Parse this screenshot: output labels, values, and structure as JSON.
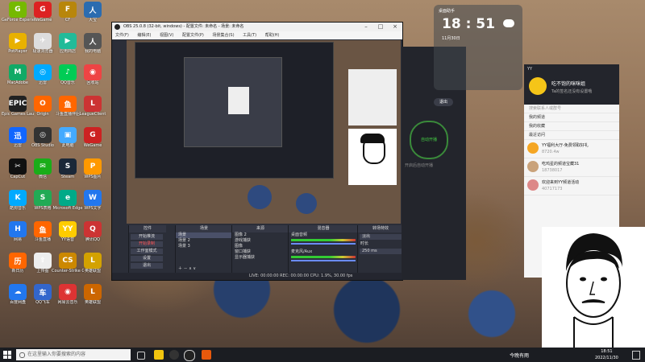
{
  "desktop": {
    "icons": [
      {
        "label": "GeForce Experience",
        "color": "#76b900",
        "glyph": "G"
      },
      {
        "label": "WeGame",
        "color": "#d22",
        "glyph": "G"
      },
      {
        "label": "CF",
        "color": "#b8860b",
        "glyph": "F"
      },
      {
        "label": "大宝",
        "color": "#2b6cb0",
        "glyph": "人"
      },
      {
        "label": "PotPlayer",
        "color": "#e8b100",
        "glyph": "▶"
      },
      {
        "label": "极速浏览器",
        "color": "#ddd",
        "glyph": "✈"
      },
      {
        "label": "应用商店",
        "color": "#2b9",
        "glyph": "▶"
      },
      {
        "label": "我的电脑",
        "color": "#555",
        "glyph": "人"
      },
      {
        "label": "MacAdobe",
        "color": "#1a6",
        "glyph": "M"
      },
      {
        "label": "迅雷",
        "color": "#0af",
        "glyph": "◎"
      },
      {
        "label": "QQ音乐",
        "color": "#0c5",
        "glyph": "♪"
      },
      {
        "label": "回收站",
        "color": "#e44",
        "glyph": "◉"
      },
      {
        "label": "Epic Games Launcher",
        "color": "#222",
        "glyph": "EPIC"
      },
      {
        "label": "Origin",
        "color": "#f60",
        "glyph": "O"
      },
      {
        "label": "斗鱼直播伴侣",
        "color": "#f60",
        "glyph": "鱼"
      },
      {
        "label": "LeagueClient",
        "color": "#c33",
        "glyph": "L"
      },
      {
        "label": "迅雷",
        "color": "#16f",
        "glyph": "迅"
      },
      {
        "label": "OBS Studio",
        "color": "#333",
        "glyph": "◎"
      },
      {
        "label": "此电脑",
        "color": "#4af",
        "glyph": "▣"
      },
      {
        "label": "WeGame",
        "color": "#c22",
        "glyph": "G"
      },
      {
        "label": "CapCut",
        "color": "#111",
        "glyph": "✂"
      },
      {
        "label": "微信",
        "color": "#1aad19",
        "glyph": "✉"
      },
      {
        "label": "Steam",
        "color": "#1b2838",
        "glyph": "S"
      },
      {
        "label": "WPS图片",
        "color": "#f90",
        "glyph": "P"
      },
      {
        "label": "酷狗音乐",
        "color": "#0af",
        "glyph": "K"
      },
      {
        "label": "WPS表格",
        "color": "#2a5",
        "glyph": "S"
      },
      {
        "label": "Microsoft Edge",
        "color": "#0a8",
        "glyph": "e"
      },
      {
        "label": "WPS文字",
        "color": "#27e",
        "glyph": "W"
      },
      {
        "label": "网易",
        "color": "#27e",
        "glyph": "H"
      },
      {
        "label": "斗鱼直播",
        "color": "#f60",
        "glyph": "鱼"
      },
      {
        "label": "YY语音",
        "color": "#fc0",
        "glyph": "YY"
      },
      {
        "label": "腾讯QQ",
        "color": "#c33",
        "glyph": "Q"
      },
      {
        "label": "新日历",
        "color": "#f60",
        "glyph": "历"
      },
      {
        "label": "上传图",
        "color": "#eee",
        "glyph": "⇧"
      },
      {
        "label": "Counter-Strike Global",
        "color": "#c80",
        "glyph": "CS"
      },
      {
        "label": "英雄联盟",
        "color": "#d3a200",
        "glyph": "L"
      },
      {
        "label": "百度网盘",
        "color": "#27e",
        "glyph": "☁"
      },
      {
        "label": "QQ飞车",
        "color": "#36c",
        "glyph": "车"
      },
      {
        "label": "网易云音乐",
        "color": "#d33",
        "glyph": "◉"
      },
      {
        "label": "英雄联盟",
        "color": "#c60",
        "glyph": "L"
      }
    ]
  },
  "obs": {
    "title": "OBS 25.0.8 (32-bit, windows) - 配置文件: 未命名 - 场景: 未命名",
    "menu": [
      "文件(F)",
      "编辑(E)",
      "视图(V)",
      "配置文件(P)",
      "场景集合(S)",
      "工具(T)",
      "帮助(H)"
    ],
    "docks": {
      "scenes": {
        "title": "场景",
        "items": [
          "场景",
          "场景 2",
          "场景 3"
        ]
      },
      "sources": {
        "title": "来源",
        "items": [
          "图像 2",
          "游戏捕获",
          "图像",
          "窗口捕获",
          "显示器捕获"
        ]
      },
      "mixer": {
        "title": "混音器",
        "items": [
          "桌面音频",
          "麦克风/Aux"
        ]
      },
      "transitions": {
        "title": "转场特效",
        "items": [
          "淡出",
          "时长",
          "250 ms"
        ]
      },
      "controls": {
        "title": "控件",
        "items": [
          "开始推流",
          "开始录制",
          "工作室模式",
          "设置",
          "退出"
        ]
      }
    },
    "status": "LIVE: 00:00:00   REC: 00:00:00   CPU: 1.9%, 30.00 fps"
  },
  "clock_widget": {
    "label": "桌面助手",
    "time": "18 : 51",
    "date": "11月30日"
  },
  "dark_app": {
    "button": "退出",
    "circle": "自动开播",
    "note": "开启后自动开播"
  },
  "chat": {
    "title": "YY",
    "nickname": "吃不饱的咪咪姐",
    "status": "Ta的签名还没有设置哦",
    "search": "搜索联系人或群号",
    "rows": [
      "我的频道",
      "我的收藏",
      "最近访问"
    ],
    "contacts": [
      {
        "name": "YY福利大厅-免费领取好礼",
        "sub": "8720.4w"
      },
      {
        "name": "吃鸡星的频道宝藏31",
        "sub": "18738017"
      },
      {
        "name": "欢迎来到YY频道活动",
        "sub": "40717173"
      }
    ]
  },
  "taskbar": {
    "search_placeholder": "在这里输入你要搜索的内容",
    "weather": "今晚有雨",
    "time": "18:51",
    "date": "2022/11/30"
  }
}
